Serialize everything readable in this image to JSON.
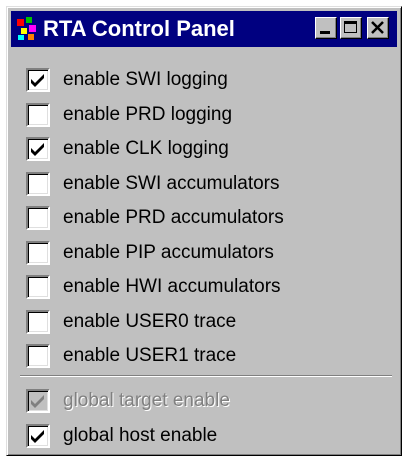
{
  "window": {
    "title": "RTA Control Panel",
    "icon": "rta-app-icon",
    "title_bar_color": "#000080",
    "buttons": [
      "minimize",
      "maximize",
      "close"
    ]
  },
  "options": [
    {
      "label": "enable SWI logging",
      "checked": true,
      "enabled": true
    },
    {
      "label": "enable PRD logging",
      "checked": false,
      "enabled": true
    },
    {
      "label": "enable CLK logging",
      "checked": true,
      "enabled": true
    },
    {
      "label": "enable SWI accumulators",
      "checked": false,
      "enabled": true
    },
    {
      "label": "enable PRD accumulators",
      "checked": false,
      "enabled": true
    },
    {
      "label": "enable PIP accumulators",
      "checked": false,
      "enabled": true
    },
    {
      "label": "enable HWI accumulators",
      "checked": false,
      "enabled": true
    },
    {
      "label": "enable USER0 trace",
      "checked": false,
      "enabled": true
    },
    {
      "label": "enable USER1 trace",
      "checked": false,
      "enabled": true
    }
  ],
  "global_options": [
    {
      "label": "global target enable",
      "checked": true,
      "enabled": false
    },
    {
      "label": "global host enable",
      "checked": true,
      "enabled": true
    }
  ]
}
